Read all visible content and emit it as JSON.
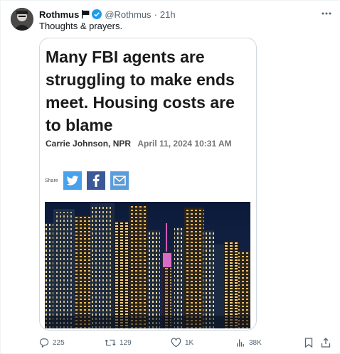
{
  "tweet": {
    "display_name": "Rothmus",
    "handle": "@Rothmus",
    "separator": "·",
    "time": "21h",
    "text": "Thoughts & prayers.",
    "flag_icon": "black-flag-icon",
    "verified_icon": "verified-badge-icon",
    "more_icon": "more-horizontal-icon"
  },
  "card": {
    "headline": "Many FBI agents are struggling to make ends meet. Housing costs are to blame",
    "author": "Carrie Johnson, NPR",
    "date": "April 11, 2024 10:31 AM",
    "share_label": "Share",
    "share_buttons": [
      "twitter-icon",
      "facebook-icon",
      "email-icon"
    ],
    "photo_icon": "city-skyline-night-photo"
  },
  "actions": {
    "replies": "225",
    "reposts": "129",
    "likes": "1K",
    "views": "38K",
    "icons": [
      "reply-icon",
      "repost-icon",
      "like-icon",
      "views-icon",
      "bookmark-icon",
      "share-icon"
    ]
  },
  "colors": {
    "verified": "#1d9bf0",
    "muted_text": "#536471",
    "twitter_blue": "#4aa1eb",
    "facebook_blue": "#3b5998",
    "mail_blue": "#5b9dd9"
  }
}
